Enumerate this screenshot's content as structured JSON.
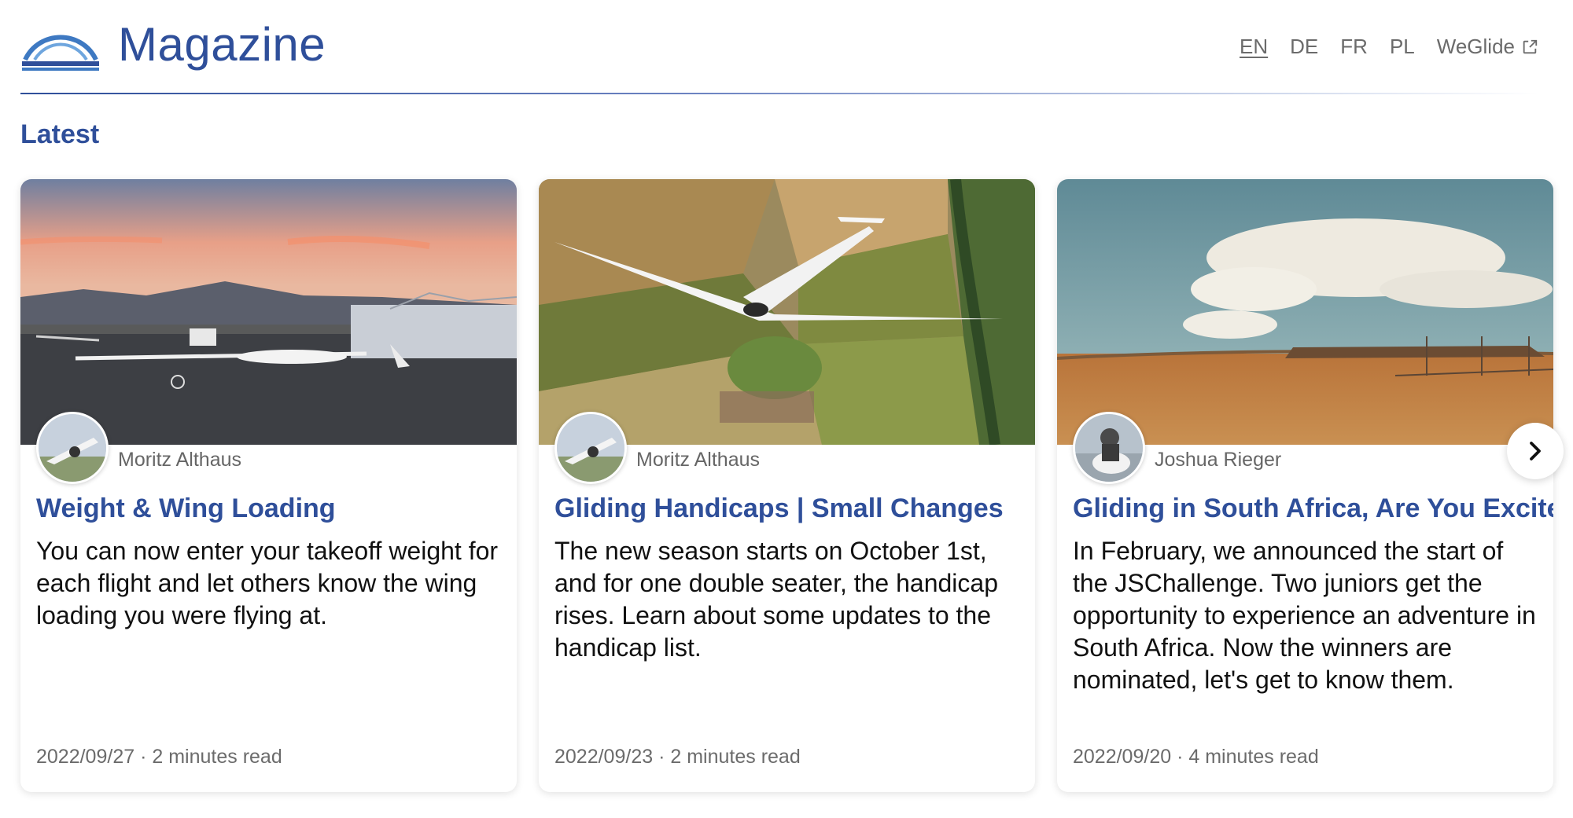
{
  "header": {
    "brand": "Magazine",
    "languages": [
      {
        "label": "EN",
        "active": true
      },
      {
        "label": "DE",
        "active": false
      },
      {
        "label": "FR",
        "active": false
      },
      {
        "label": "PL",
        "active": false
      }
    ],
    "external_link": "WeGlide"
  },
  "section": {
    "title": "Latest"
  },
  "cards": [
    {
      "author": "Moritz Althaus",
      "title": "Weight & Wing Loading",
      "excerpt": "You can now enter your takeoff weight for each flight and let others know the wing loading you were flying at.",
      "date": "2022/09/27",
      "read_time": "2 minutes read",
      "image": "glider-on-runway-at-sunset"
    },
    {
      "author": "Moritz Althaus",
      "title": "Gliding Handicaps | Small Changes",
      "excerpt": "The new season starts on October 1st, and for one double seater, the handicap rises. Learn about some updates to the handicap list.",
      "date": "2022/09/23",
      "read_time": "2 minutes read",
      "image": "glider-flying-over-fields"
    },
    {
      "author": "Joshua Rieger",
      "title": "Gliding in South Africa, Are You Excited?",
      "excerpt": "In February, we announced the start of the JSChallenge. Two juniors get the opportunity to experience an adventure in South Africa. Now the winners are nominated, let's get to know them.",
      "date": "2022/09/20",
      "read_time": "4 minutes read",
      "image": "south-african-savanna-with-clouds"
    }
  ],
  "separator": "·",
  "colors": {
    "brand": "#2f4f9a",
    "text": "#111111",
    "muted": "#6b6b6b"
  }
}
